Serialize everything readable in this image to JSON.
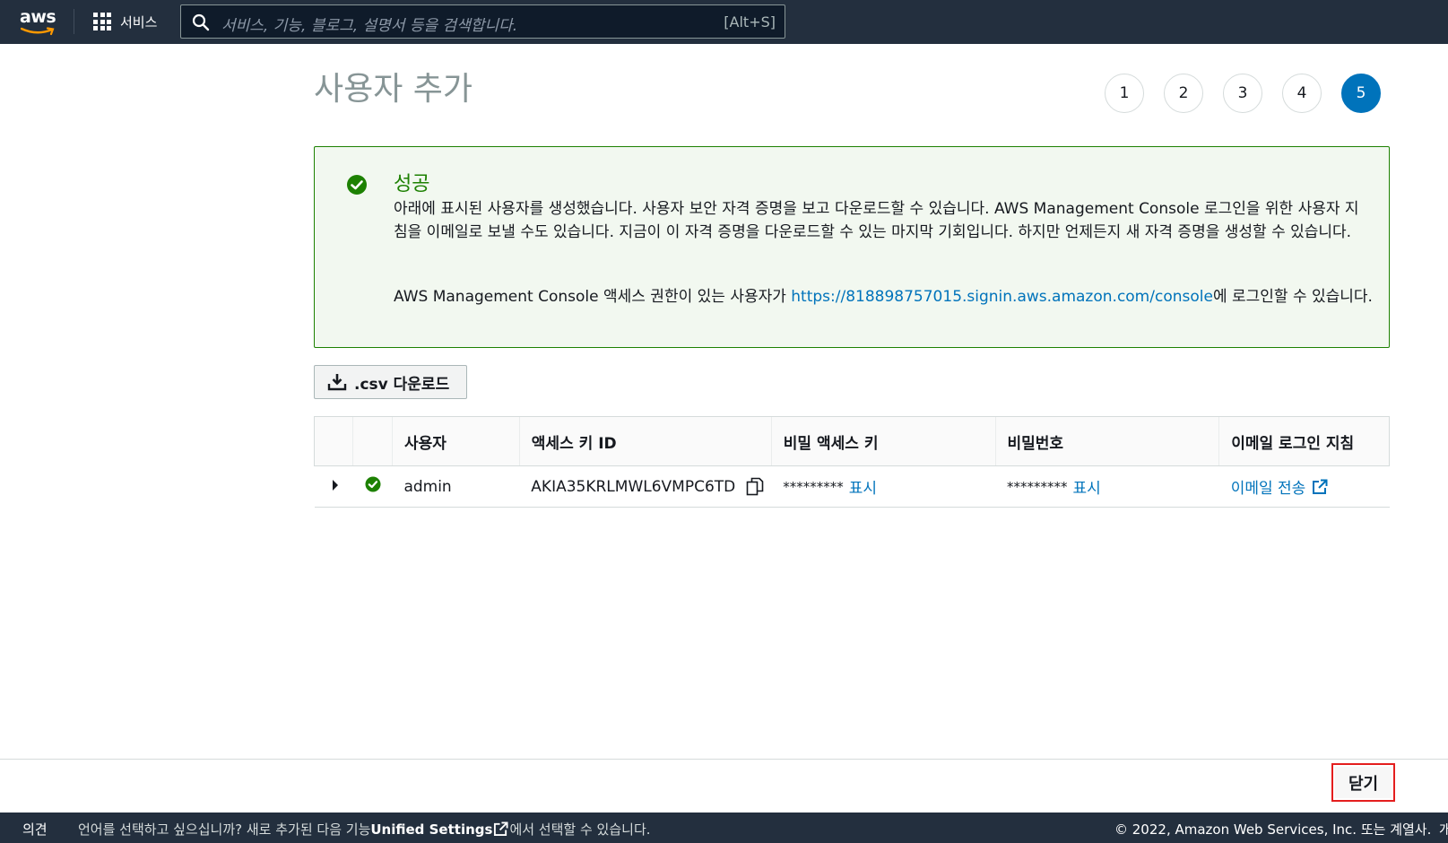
{
  "nav": {
    "logo_text": "aws",
    "services_label": "서비스",
    "search_placeholder": "서비스, 기능, 블로그, 설명서 등을 검색합니다.",
    "search_shortcut": "[Alt+S]"
  },
  "page": {
    "title": "사용자 추가",
    "steps": [
      "1",
      "2",
      "3",
      "4",
      "5"
    ],
    "active_step": "5"
  },
  "alert": {
    "heading": "성공",
    "body": "아래에 표시된 사용자를 생성했습니다. 사용자 보안 자격 증명을 보고 다운로드할 수 있습니다. AWS Management Console 로그인을 위한 사용자 지침을 이메일로 보낼 수도 있습니다. 지금이 이 자격 증명을 다운로드할 수 있는 마지막 기회입니다. 하지만 언제든지 새 자격 증명을 생성할 수 있습니다.",
    "console_prefix": "AWS Management Console 액세스 권한이 있는 사용자가 ",
    "console_url": "https://818898757015.signin.aws.amazon.com/console",
    "console_suffix": "에 로그인할 수 있습니다."
  },
  "csv_button": ".csv 다운로드",
  "table": {
    "headers": [
      "사용자",
      "액세스 키 ID",
      "비밀 액세스 키",
      "비밀번호",
      "이메일 로그인 지침"
    ],
    "rows": [
      {
        "user": "admin",
        "access_key_id": "AKIA35KRLMWL6VMPC6TD",
        "secret_masked": "*********",
        "secret_show": "표시",
        "password_masked": "*********",
        "password_show": "표시",
        "email_link": "이메일 전송"
      }
    ]
  },
  "footer": {
    "close_label": "닫기",
    "feedback": "의견",
    "lang_prefix": "언어를 선택하고 싶으십니까? 새로 추가된 다음 기능",
    "unified_settings": "Unified Settings",
    "lang_suffix": "에서 선택할 수 있습니다.",
    "copyright": "© 2022, Amazon Web Services, Inc. 또는 계열사.",
    "edge_text": "개"
  },
  "colors": {
    "nav_bg": "#232f3e",
    "success": "#1d8102",
    "link": "#0073bb",
    "highlight_border": "#e41e1e"
  }
}
